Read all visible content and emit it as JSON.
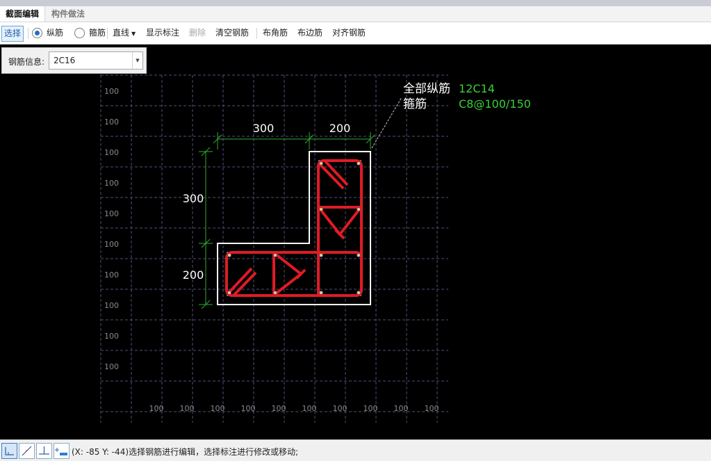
{
  "tabs": {
    "active": "截面编辑",
    "inactive": "构件做法"
  },
  "toolbar": {
    "select": "选择",
    "radio_longitudinal": "纵筋",
    "radio_stirrup": "箍筋",
    "line_mode": "直线",
    "show_annotation": "显示标注",
    "delete": "删除",
    "clear_rebar": "清空钢筋",
    "corner_rebar": "布角筋",
    "edge_rebar": "布边筋",
    "align_rebar": "对齐钢筋"
  },
  "rebar_info": {
    "label": "钢筋信息:",
    "value": "2C16"
  },
  "canvas": {
    "grid_label": "100",
    "dimensions": {
      "top_left": "300",
      "top_right": "200",
      "left_top": "300",
      "left_bottom": "200"
    },
    "annotation": {
      "longitudinal_label": "全部纵筋",
      "longitudinal_value": "12C14",
      "stirrup_label": "箍筋",
      "stirrup_value": "C8@100/150"
    },
    "colors": {
      "section_outline": "#ffffff",
      "rebar": "#e01b24",
      "dimension": "#2fae2f",
      "annotation_value": "#39d039",
      "grid": "#50507a"
    }
  },
  "statusbar": {
    "coordinates": "(X: -85 Y: -44)",
    "message": "选择钢筋进行编辑，选择标注进行修改或移动;",
    "icons": [
      "ortho-icon",
      "line-snap-icon",
      "perpendicular-icon",
      "dimension-icon"
    ]
  }
}
